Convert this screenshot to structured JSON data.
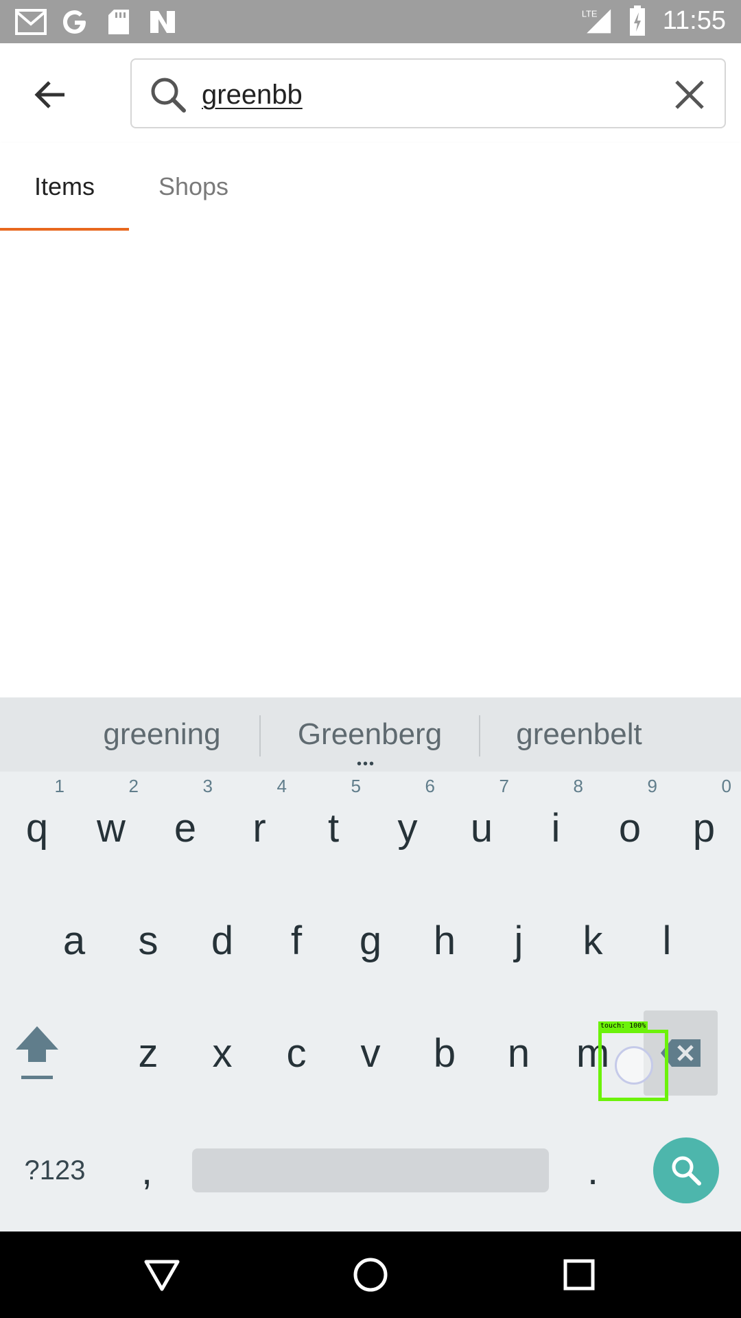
{
  "status_bar": {
    "time": "11:55",
    "left_icons": [
      "gmail-icon",
      "google-icon",
      "sd-card-icon",
      "n-icon"
    ],
    "network": "LTE"
  },
  "search": {
    "query": "greenbb",
    "back_icon": "arrow-back-icon",
    "search_icon": "search-icon",
    "clear_icon": "close-icon"
  },
  "tabs": [
    {
      "label": "Items",
      "active": true
    },
    {
      "label": "Shops",
      "active": false
    }
  ],
  "accent_color": "#e8681e",
  "keyboard": {
    "suggestions": [
      "greening",
      "Greenberg",
      "greenbelt"
    ],
    "row1": [
      {
        "key": "q",
        "hint": "1"
      },
      {
        "key": "w",
        "hint": "2"
      },
      {
        "key": "e",
        "hint": "3"
      },
      {
        "key": "r",
        "hint": "4"
      },
      {
        "key": "t",
        "hint": "5"
      },
      {
        "key": "y",
        "hint": "6"
      },
      {
        "key": "u",
        "hint": "7"
      },
      {
        "key": "i",
        "hint": "8"
      },
      {
        "key": "o",
        "hint": "9"
      },
      {
        "key": "p",
        "hint": "0"
      }
    ],
    "row2": [
      "a",
      "s",
      "d",
      "f",
      "g",
      "h",
      "j",
      "k",
      "l"
    ],
    "row3": [
      "z",
      "x",
      "c",
      "v",
      "b",
      "n",
      "m"
    ],
    "symbols_label": "?123",
    "comma": ",",
    "period": ".",
    "search_key_color": "#4db6ac"
  },
  "touch_overlay": {
    "label": "touch: 100%",
    "color": "#6cf20a"
  },
  "nav_bar": {
    "icons": [
      "nav-back-icon",
      "nav-home-icon",
      "nav-recents-icon"
    ]
  }
}
